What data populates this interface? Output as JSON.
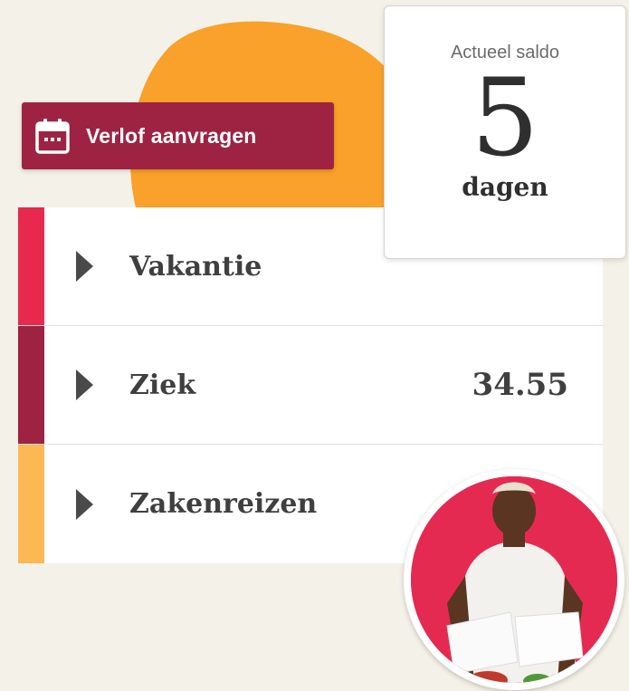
{
  "leave_request": {
    "label": "Verlof aanvragen",
    "icon": "calendar-icon"
  },
  "balance": {
    "caption": "Actueel saldo",
    "value": "5",
    "unit": "dagen"
  },
  "categories": [
    {
      "label": "Vakantie",
      "value": "",
      "color": "#e8294e"
    },
    {
      "label": "Ziek",
      "value": "34.55",
      "color": "#9e2342"
    },
    {
      "label": "Zakenreizen",
      "value": "",
      "color": "#fdb856"
    }
  ],
  "colors": {
    "accent_orange": "#f9a12a",
    "button": "#9e2342",
    "background": "#f4f1e8",
    "avatar_bg": "#e52a52"
  }
}
